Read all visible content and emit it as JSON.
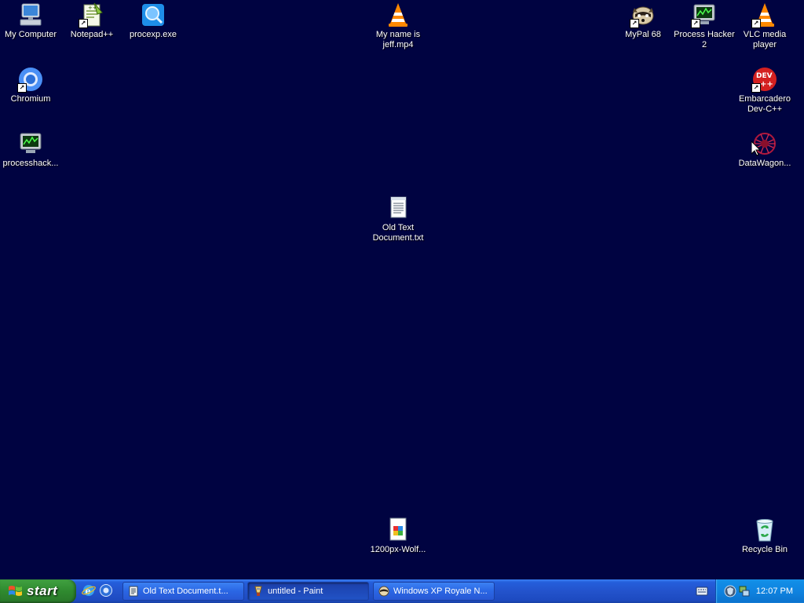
{
  "desktop": {
    "icons": {
      "my_computer": "My Computer",
      "notepadpp": "Notepad++",
      "procexp": "procexp.exe",
      "my_name_is_jeff_1": "My name is",
      "my_name_is_jeff_2": "jeff.mp4",
      "mypal": "MyPal 68",
      "process_hacker_1": "Process Hacker",
      "process_hacker_2": "2",
      "vlc_1": "VLC media",
      "vlc_2": "player",
      "chromium": "Chromium",
      "embarcadero_1": "Embarcadero",
      "embarcadero_2": "Dev-C++",
      "processhack": "processhack...",
      "datawagon": "DataWagon...",
      "old_text_1": "Old Text",
      "old_text_2": "Document.txt",
      "wolf": "1200px-Wolf...",
      "recycle_bin": "Recycle Bin"
    }
  },
  "taskbar": {
    "start_label": "start",
    "tasks": [
      {
        "label": "Old Text Document.t...",
        "icon": "notepad-icon"
      },
      {
        "label": "untitled - Paint",
        "icon": "paint-icon"
      },
      {
        "label": "Windows XP Royale N...",
        "icon": "browser-icon"
      }
    ],
    "clock": "12:07 PM"
  },
  "colors": {
    "desktop_background": "#000341",
    "taskbar_blue": "#245edb",
    "start_green": "#3d9c3d",
    "tray_blue": "#0f83e0"
  }
}
